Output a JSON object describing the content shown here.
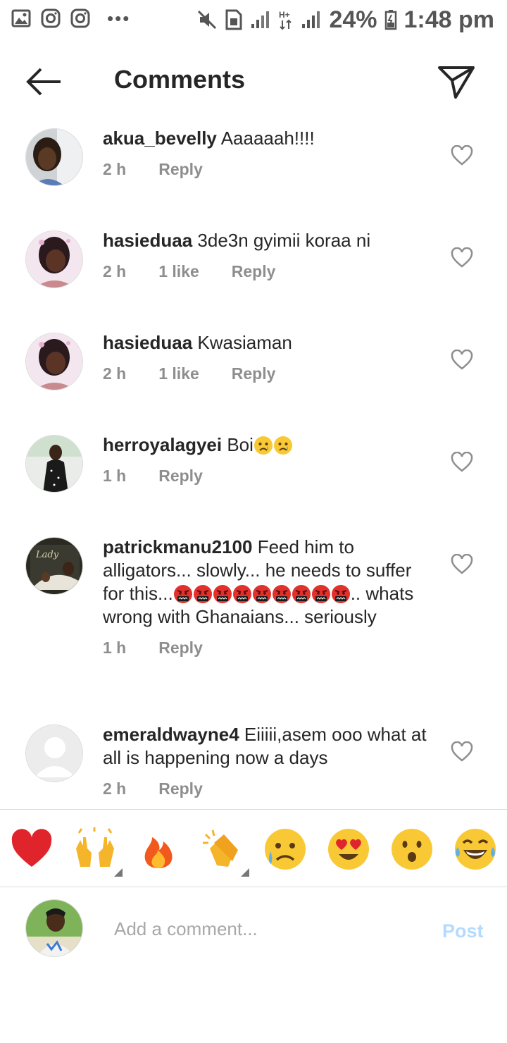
{
  "status_bar": {
    "battery": "24%",
    "time": "1:48 pm",
    "network": "H+",
    "icons": [
      "gallery-icon",
      "instagram-icon",
      "instagram-icon",
      "more-dots-icon",
      "mute-icon",
      "sim-icon",
      "signal-icon",
      "data-arrows-icon",
      "signal-icon",
      "battery-icon"
    ]
  },
  "header": {
    "title": "Comments",
    "back_icon": "arrow-left-icon",
    "send_icon": "direct-send-icon"
  },
  "comments": [
    {
      "username": "akua_bevelly",
      "text": "Aaaaaah!!!!",
      "time": "2 h",
      "likes": "",
      "reply": "Reply"
    },
    {
      "username": "hasieduaa",
      "text": "3de3n gyimii koraa ni",
      "time": "2 h",
      "likes": "1 like",
      "reply": "Reply"
    },
    {
      "username": "hasieduaa",
      "text": "Kwasiaman",
      "time": "2 h",
      "likes": "1 like",
      "reply": "Reply"
    },
    {
      "username": "herroyalagyei",
      "text": "Boi",
      "emojis": [
        "crying-face-icon",
        "crying-face-icon"
      ],
      "time": "1 h",
      "likes": "",
      "reply": "Reply"
    },
    {
      "username": "patrickmanu2100",
      "text": "Feed him to alligators... slowly... he needs to suffer for this...",
      "emojis": [
        "cursing-face-icon",
        "cursing-face-icon",
        "cursing-face-icon",
        "cursing-face-icon",
        "cursing-face-icon",
        "cursing-face-icon",
        "cursing-face-icon",
        "cursing-face-icon",
        "cursing-face-icon"
      ],
      "text_after": ".. whats wrong with Ghanaians... seriously",
      "time": "1 h",
      "likes": "",
      "reply": "Reply"
    },
    {
      "username": "emeraldwayne4",
      "text": "Eiiiii,asem ooo what at all is happening now a days",
      "time": "2 h",
      "likes": "",
      "reply": "Reply"
    }
  ],
  "quick_reactions": [
    "red-heart-icon",
    "raised-hands-icon",
    "fire-icon",
    "clapping-hands-icon",
    "crying-face-icon",
    "heart-eyes-icon",
    "surprised-face-icon",
    "tears-of-joy-icon"
  ],
  "compose": {
    "placeholder": "Add a comment...",
    "post_label": "Post"
  },
  "colors": {
    "text": "#262626",
    "meta": "#8e8e8e",
    "post_disabled": "#b3dbff",
    "divider": "#dbdbdb"
  }
}
